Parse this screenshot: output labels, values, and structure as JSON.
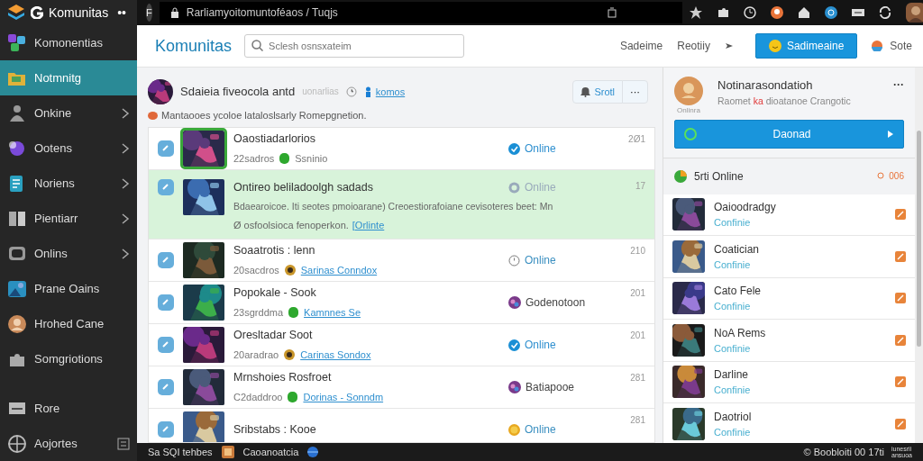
{
  "sidebar": {
    "brand": "Komunitas",
    "brand_menu": "••",
    "items": [
      {
        "label": "Komonentias",
        "selected": false,
        "expandable": false
      },
      {
        "label": "Notmnitg",
        "selected": true,
        "expandable": false
      },
      {
        "label": "Onkine",
        "selected": false,
        "expandable": true
      },
      {
        "label": "Ootens",
        "selected": false,
        "expandable": true
      },
      {
        "label": "Noriens",
        "selected": false,
        "expandable": true
      },
      {
        "label": "Pientiarr",
        "selected": false,
        "expandable": true
      },
      {
        "label": "Onlins",
        "selected": false,
        "expandable": true
      },
      {
        "label": "Prane Oains",
        "selected": false,
        "expandable": false
      },
      {
        "label": "Hrohed Cane",
        "selected": false,
        "expandable": false
      },
      {
        "label": "Somgriotions",
        "selected": false,
        "expandable": false
      }
    ],
    "footer_items": [
      {
        "label": "Rore"
      },
      {
        "label": "Aojortes"
      }
    ]
  },
  "browser": {
    "tab_button": "F",
    "address": "Rarliamyoitomuntoféaos / Tuqjs"
  },
  "header": {
    "title": "Komunitas",
    "search": {
      "placeholder": "Sclesh osnsxateim"
    },
    "links": [
      "Sadeime",
      "Reotiiy"
    ],
    "primary_button": "Sadimeaine",
    "profile_link": "Sote"
  },
  "post": {
    "title": "Sdaieia fiveocola antd",
    "subtitle": "uonarlias",
    "tag": "komos",
    "note": "Mantaooes ycoloe lataloslsarly Romepgnetion.",
    "follow_button": "Srotl",
    "more_button": "···"
  },
  "rows": [
    {
      "kind": "compact",
      "selected": false,
      "title": "Oaostiadarlorios",
      "count": "22sadros",
      "meta": {
        "kind": "dot",
        "text": "Ssninio"
      },
      "status": {
        "kind": "check",
        "text": "Online"
      },
      "number": "2Ø1"
    },
    {
      "kind": "expanded",
      "selected": true,
      "title": "Ontireo beliladoolgh sadads",
      "description": "Bdaearoicoe. Iti seotes pmoioarane) Creoestiorafoiane cevisoteres beet: Mn",
      "description_2": "Ø osfoolsioca fenoperkon.",
      "link": "[Orlinte",
      "status": {
        "kind": "faded",
        "text": "Online"
      },
      "number": "17"
    },
    {
      "kind": "compact",
      "selected": false,
      "title": "Soaatrotis : lenn",
      "count": "20sacdros",
      "meta": {
        "kind": "coin",
        "text": "Sarinas Conndox"
      },
      "status": {
        "kind": "clock",
        "text": "Online"
      },
      "number": "210"
    },
    {
      "kind": "compact",
      "selected": false,
      "title": "Popokale - Sook",
      "count": "23sgrddma",
      "meta": {
        "kind": "dot",
        "text": "Kamnnes Se"
      },
      "status": {
        "kind": "avatar",
        "text": "Godenotoon"
      },
      "number": "201"
    },
    {
      "kind": "compact",
      "selected": false,
      "title": "Oresltadar Soot",
      "count": "20aradrao",
      "meta": {
        "kind": "coin",
        "text": "Carinas Sondox"
      },
      "status": {
        "kind": "check",
        "text": "Online"
      },
      "number": "201"
    },
    {
      "kind": "compact",
      "selected": false,
      "title": "Mrnshoies Rosfroet",
      "count": "C2daddroo",
      "meta": {
        "kind": "dot",
        "text": "Dorinas - Sonndm"
      },
      "status": {
        "kind": "avatar",
        "text": "Batiapooe"
      },
      "number": "281"
    },
    {
      "kind": "compact",
      "selected": false,
      "title": "Sribstabs : Kooe",
      "status": {
        "kind": "coin",
        "text": "Online"
      },
      "number": "281"
    }
  ],
  "profile": {
    "name": "Notinarasondatioh",
    "desc_before": "Raomet",
    "desc_highlight": "ka",
    "desc_after": "dioatanoe Crangotic",
    "avatar_caption": "Onlinra",
    "more": "···",
    "action_button": "Daonad"
  },
  "online_panel": {
    "title": "5rti Online",
    "count": "006",
    "members": [
      {
        "name": "Oaioodradgy",
        "status": "Confinie"
      },
      {
        "name": "Coatician",
        "status": "Confinie"
      },
      {
        "name": "Cato Fele",
        "status": "Confinie"
      },
      {
        "name": "NoA Rems",
        "status": "Confinie"
      },
      {
        "name": "Darline",
        "status": "Confinie"
      },
      {
        "name": "Daotriol",
        "status": "Confinie"
      }
    ]
  },
  "status_bar": {
    "left": "Sa SQI tehbes",
    "middle": "Caoanoatcia",
    "right": "© Boobloiti 00 17ti",
    "small_1": "iunesrii",
    "small_2": "ansuoa"
  }
}
